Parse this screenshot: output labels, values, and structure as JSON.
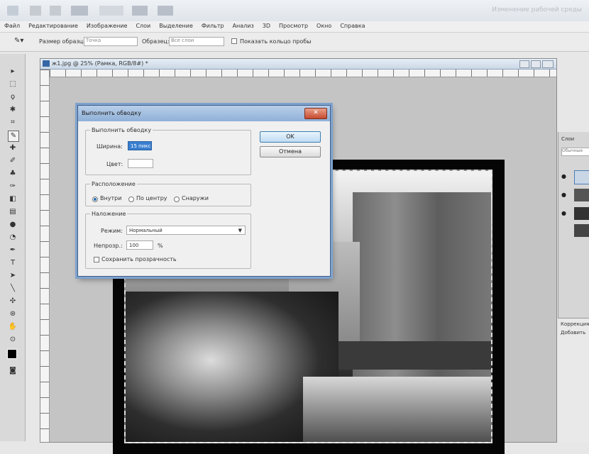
{
  "appbar": {
    "workspace_label": "Изменение рабочей среды"
  },
  "menu": {
    "items": [
      "Файл",
      "Редактирование",
      "Изображение",
      "Слои",
      "Выделение",
      "Фильтр",
      "Анализ",
      "3D",
      "Просмотр",
      "Окно",
      "Справка"
    ]
  },
  "options": {
    "sample_size_label": "Размер образца:",
    "sample_size_value": "Точка",
    "samples_label": "Образец:",
    "samples_value": "Все слои",
    "show_ring_label": "Показать кольцо пробы"
  },
  "document": {
    "title": "ж1.jpg @ 25% (Рамка, RGB/8#) *"
  },
  "dialog": {
    "title": "Выполнить обводку",
    "stroke_group": "Выполнить обводку",
    "width_label": "Ширина:",
    "width_value": "15 пикс",
    "color_label": "Цвет:",
    "location_group": "Расположение",
    "location_options": [
      "Внутри",
      "По центру",
      "Снаружи"
    ],
    "location_selected": "Внутри",
    "blend_group": "Наложение",
    "mode_label": "Режим:",
    "mode_value": "Нормальный",
    "opacity_label": "Непрозр.:",
    "opacity_value": "100",
    "opacity_unit": "%",
    "preserve_label": "Сохранить прозрачность",
    "ok_label": "OK",
    "cancel_label": "Отмена"
  },
  "panels": {
    "layers_tab": "Слои",
    "blend_mode": "Обычные",
    "corrections_tab": "Коррекция",
    "add_correction": "Добавить"
  },
  "colors": {
    "dialog_title_bar": "#8fb0d8",
    "default_button_border": "#3c7fb1",
    "frame_black": "#050505"
  }
}
